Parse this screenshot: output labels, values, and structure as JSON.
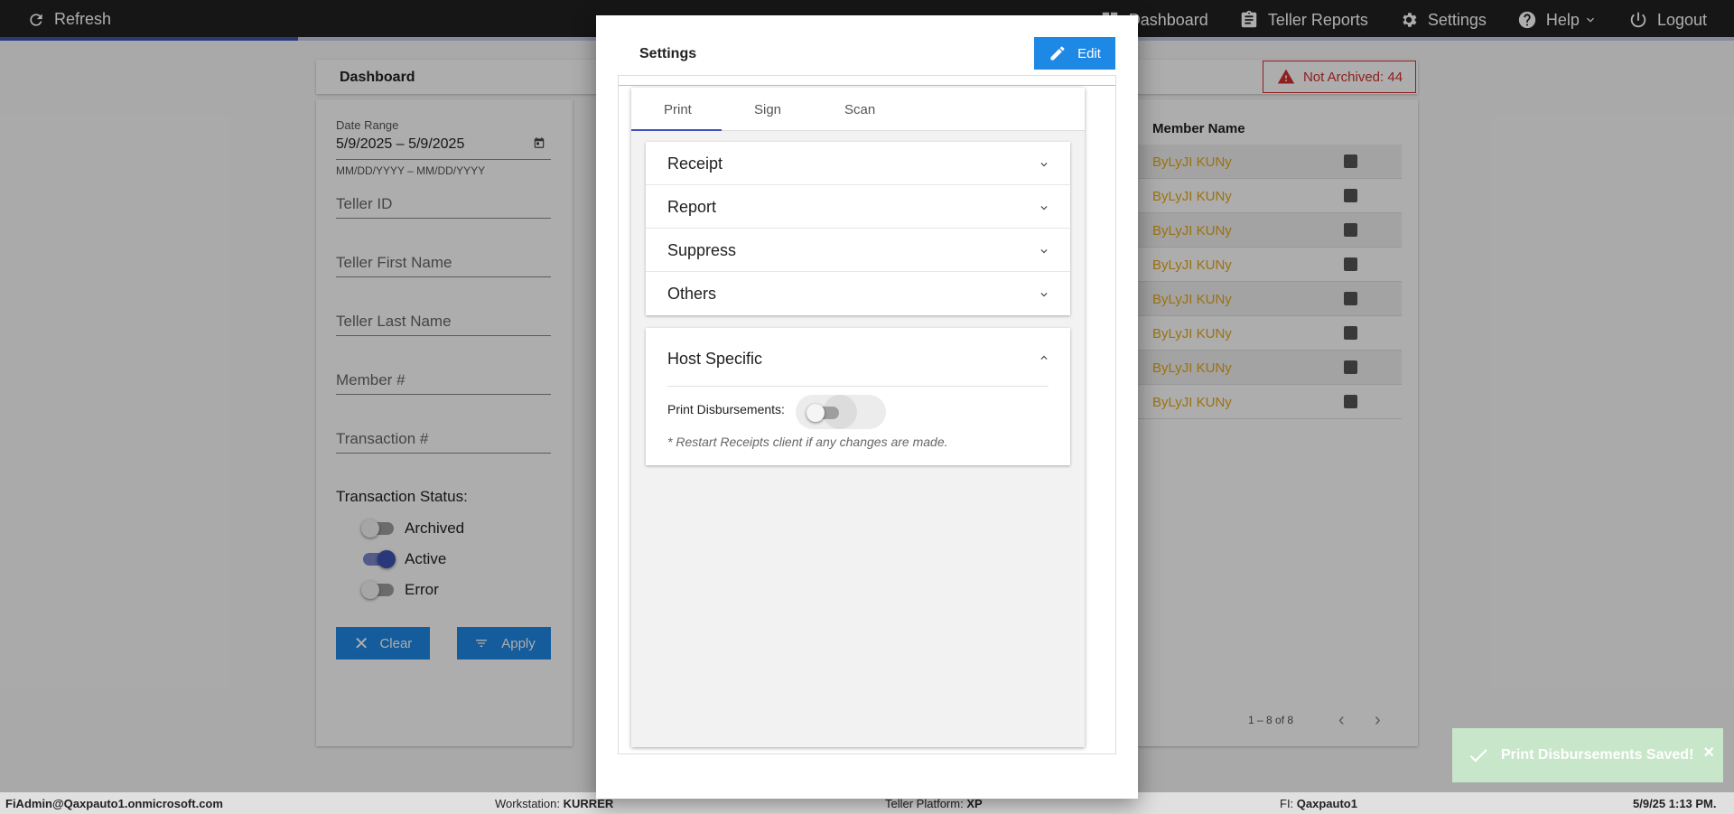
{
  "topbar": {
    "refresh_label": "Refresh",
    "nav": [
      {
        "icon": "dashboard-icon",
        "label": "Dashboard"
      },
      {
        "icon": "clipboard-icon",
        "label": "Teller Reports"
      },
      {
        "icon": "gear-icon",
        "label": "Settings"
      },
      {
        "icon": "help-icon",
        "label": "Help"
      },
      {
        "icon": "power-icon",
        "label": "Logout"
      }
    ]
  },
  "dashboard": {
    "title": "Dashboard",
    "alert_label": "Not Archived: 44",
    "filters": {
      "date_range_label": "Date Range",
      "date_range_value": "5/9/2025 – 5/9/2025",
      "date_range_hint": "MM/DD/YYYY – MM/DD/YYYY",
      "teller_id": "Teller ID",
      "teller_first_name": "Teller First Name",
      "teller_last_name": "Teller Last Name",
      "member_number": "Member #",
      "transaction_number": "Transaction #",
      "status_label": "Transaction Status:",
      "status_archived": "Archived",
      "status_active": "Active",
      "status_error": "Error",
      "clear_label": "Clear",
      "apply_label": "Apply"
    },
    "table": {
      "header_member_name": "Member Name",
      "rows": [
        "ByLyJI KUNy",
        "ByLyJI KUNy",
        "ByLyJI KUNy",
        "ByLyJI KUNy",
        "ByLyJI KUNy",
        "ByLyJI KUNy",
        "ByLyJI KUNy",
        "ByLyJI KUNy"
      ],
      "pager": "1 – 8 of 8"
    }
  },
  "modal": {
    "title": "Settings",
    "edit_label": "Edit",
    "tabs": [
      "Print",
      "Sign",
      "Scan"
    ],
    "sections": [
      "Receipt",
      "Report",
      "Suppress",
      "Others"
    ],
    "host_specific": {
      "title": "Host Specific",
      "print_disbursements_label": "Print Disbursements:",
      "note": "* Restart Receipts client if any changes are made."
    }
  },
  "statusbar": {
    "user": "FiAdmin@Qaxpauto1.onmicrosoft.com",
    "workstation_label": "Workstation:",
    "workstation_value": "KURRER",
    "platform_label": "Teller Platform:",
    "platform_value": "XP",
    "fi_label": "FI:",
    "fi_value": "Qaxpauto1",
    "datetime": "5/9/25 1:13 PM."
  },
  "toast": {
    "message": "Print Disbursements Saved!",
    "close": "×"
  },
  "colors": {
    "accent": "#1e88e5",
    "primary": "#3f51b5",
    "alert": "#d32f2f",
    "member_link": "#e6a817",
    "toast_bg": "#c8e6c9"
  }
}
